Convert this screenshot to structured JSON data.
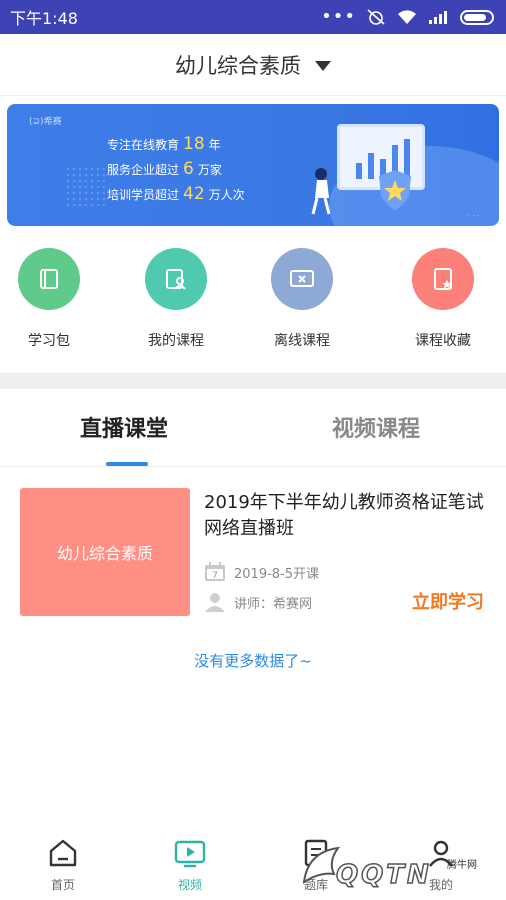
{
  "status_bar": {
    "time": "下午1:48"
  },
  "header": {
    "title": "幼儿综合素质"
  },
  "banner": {
    "logo": "希赛",
    "line1_prefix": "专注在线教育",
    "line1_num": "18",
    "line1_suffix": "年",
    "line2_prefix": "服务企业超过",
    "line2_num": "6",
    "line2_suffix": "万家",
    "line3_prefix": "培训学员超过",
    "line3_num": "42",
    "line3_suffix": "万人次"
  },
  "quick_menu": [
    {
      "label": "学习包",
      "icon": "book-icon",
      "color": "#5fca8a"
    },
    {
      "label": "我的课程",
      "icon": "my-course-icon",
      "color": "#4fc9b0"
    },
    {
      "label": "离线课程",
      "icon": "offline-icon",
      "color": "#8ea9d6"
    },
    {
      "label": "课程收藏",
      "icon": "favorite-icon",
      "color": "#fa8079"
    }
  ],
  "tabs": {
    "live": "直播课堂",
    "video": "视频课程",
    "active": "live"
  },
  "course": {
    "cover_text": "幼儿综合素质",
    "title": "2019年下半年幼儿教师资格证笔试网络直播班",
    "date": "2019-8-5开课",
    "teacher": "讲师：希赛网",
    "action": "立即学习",
    "calendar_day": "7"
  },
  "no_more": "没有更多数据了~",
  "bottom_nav": {
    "items": [
      {
        "label": "首页",
        "icon": "home-icon"
      },
      {
        "label": "视频",
        "icon": "video-icon"
      },
      {
        "label": "题库",
        "icon": "question-bank-icon"
      },
      {
        "label": "我的",
        "icon": "profile-icon"
      }
    ],
    "active": "视频"
  },
  "watermark": {
    "text": "QQTN",
    "small": "腾牛网"
  }
}
